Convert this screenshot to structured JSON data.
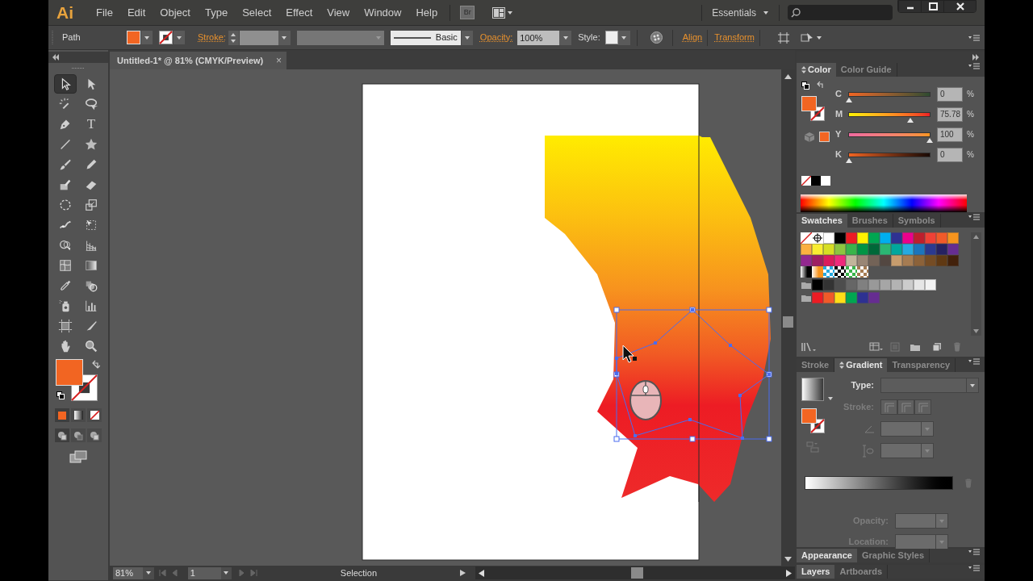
{
  "app": {
    "logo": "Ai",
    "bridge": "Br"
  },
  "menu": [
    "File",
    "Edit",
    "Object",
    "Type",
    "Select",
    "Effect",
    "View",
    "Window",
    "Help"
  ],
  "workspace": {
    "label": "Essentials"
  },
  "control_bar": {
    "selection": "Path",
    "stroke_label": "Stroke:",
    "stroke_profile": "Basic",
    "opacity_label": "Opacity:",
    "opacity": "100%",
    "style_label": "Style:",
    "align": "Align",
    "transform": "Transform"
  },
  "fill": {
    "color": "#f26522"
  },
  "document_tab": {
    "title": "Untitled-1* @ 81% (CMYK/Preview)",
    "close": "×"
  },
  "tools": [
    {
      "kind": "selection",
      "selected": true
    },
    {
      "kind": "direct-selection",
      "selected": false
    },
    {
      "kind": "magic-wand",
      "selected": false
    },
    {
      "kind": "lasso",
      "selected": false
    },
    {
      "kind": "pen",
      "selected": false
    },
    {
      "kind": "type",
      "glyph": "T",
      "selected": false
    },
    {
      "kind": "line",
      "selected": false
    },
    {
      "kind": "star",
      "selected": false
    },
    {
      "kind": "paintbrush",
      "selected": false
    },
    {
      "kind": "pencil",
      "selected": false
    },
    {
      "kind": "blob-brush",
      "selected": false
    },
    {
      "kind": "eraser",
      "selected": false
    },
    {
      "kind": "rotate",
      "selected": false
    },
    {
      "kind": "scale",
      "selected": false
    },
    {
      "kind": "warp",
      "selected": false
    },
    {
      "kind": "free-transform",
      "selected": false
    },
    {
      "kind": "shape-builder",
      "selected": false
    },
    {
      "kind": "perspective-grid",
      "selected": false
    },
    {
      "kind": "mesh",
      "selected": false
    },
    {
      "kind": "gradient",
      "selected": false
    },
    {
      "kind": "eyedropper",
      "selected": false
    },
    {
      "kind": "blend",
      "selected": false
    },
    {
      "kind": "symbol-sprayer",
      "selected": false
    },
    {
      "kind": "column-graph",
      "selected": false
    },
    {
      "kind": "artboard",
      "selected": false
    },
    {
      "kind": "slice",
      "selected": false
    },
    {
      "kind": "hand",
      "selected": false
    },
    {
      "kind": "zoom",
      "selected": false
    }
  ],
  "color_panel": {
    "tabs": [
      {
        "label": "Color",
        "selected": true,
        "collapsible": true
      },
      {
        "label": "Color Guide",
        "selected": false
      }
    ],
    "channels": [
      {
        "label": "C",
        "value": "0",
        "unit": "%",
        "level": 0
      },
      {
        "label": "M",
        "value": "75.78",
        "unit": "%",
        "level": 0.7578
      },
      {
        "label": "Y",
        "value": "100",
        "unit": "%",
        "level": 1
      },
      {
        "label": "K",
        "value": "0",
        "unit": "%",
        "level": 0
      }
    ]
  },
  "swatches_panel": {
    "tabs": [
      {
        "label": "Swatches",
        "selected": true
      },
      {
        "label": "Brushes",
        "selected": false
      },
      {
        "label": "Symbols",
        "selected": false
      }
    ],
    "rows": [
      [
        {
          "kind": "none"
        },
        {
          "kind": "registration"
        },
        {
          "kind": "color",
          "color": "#ffffff"
        },
        {
          "kind": "color",
          "color": "#000000"
        },
        {
          "kind": "color",
          "color": "#ed1c24"
        },
        {
          "kind": "color",
          "color": "#fff200"
        },
        {
          "kind": "color",
          "color": "#00a651"
        },
        {
          "kind": "color",
          "color": "#00aeef"
        },
        {
          "kind": "color",
          "color": "#2e3192"
        },
        {
          "kind": "color",
          "color": "#ec008c"
        },
        {
          "kind": "color",
          "color": "#be1e2d"
        },
        {
          "kind": "color",
          "color": "#ef4136"
        },
        {
          "kind": "color",
          "color": "#f15a29"
        },
        {
          "kind": "color",
          "color": "#f7941d"
        }
      ],
      [
        {
          "kind": "color",
          "color": "#fbb040"
        },
        {
          "kind": "color",
          "color": "#f9ed32"
        },
        {
          "kind": "color",
          "color": "#d7df23"
        },
        {
          "kind": "color",
          "color": "#8dc63f"
        },
        {
          "kind": "color",
          "color": "#39b54a"
        },
        {
          "kind": "color",
          "color": "#009444"
        },
        {
          "kind": "color",
          "color": "#006838"
        },
        {
          "kind": "color",
          "color": "#2bb673"
        },
        {
          "kind": "color",
          "color": "#00a79d"
        },
        {
          "kind": "color",
          "color": "#27aae1"
        },
        {
          "kind": "color",
          "color": "#1c75bc"
        },
        {
          "kind": "color",
          "color": "#2b3990"
        },
        {
          "kind": "color",
          "color": "#262262"
        },
        {
          "kind": "color",
          "color": "#662d91"
        }
      ],
      [
        {
          "kind": "color",
          "color": "#92278f"
        },
        {
          "kind": "color",
          "color": "#9e1f63"
        },
        {
          "kind": "color",
          "color": "#da1c5c"
        },
        {
          "kind": "color",
          "color": "#ee2a7b"
        },
        {
          "kind": "color",
          "color": "#c2b59b"
        },
        {
          "kind": "color",
          "color": "#998675"
        },
        {
          "kind": "color",
          "color": "#736357"
        },
        {
          "kind": "color",
          "color": "#534741"
        },
        {
          "kind": "color",
          "color": "#c69c6d"
        },
        {
          "kind": "color",
          "color": "#a67c52"
        },
        {
          "kind": "color",
          "color": "#8c6239"
        },
        {
          "kind": "color",
          "color": "#754c24"
        },
        {
          "kind": "color",
          "color": "#603913"
        },
        {
          "kind": "color",
          "color": "#42210b"
        }
      ],
      [
        {
          "kind": "gradient",
          "color": "#000000"
        },
        {
          "kind": "gradient",
          "color": "#f7941d"
        },
        {
          "kind": "pattern",
          "color": "#27aae1"
        },
        {
          "kind": "pattern",
          "color": "#000000"
        },
        {
          "kind": "pattern",
          "color": "#39b54a"
        },
        {
          "kind": "pattern",
          "color": "#a67c52"
        }
      ],
      [
        {
          "kind": "folder"
        },
        {
          "kind": "color",
          "color": "#000000"
        },
        {
          "kind": "color",
          "color": "#333333"
        },
        {
          "kind": "color",
          "color": "#4d4d4d"
        },
        {
          "kind": "color",
          "color": "#666666"
        },
        {
          "kind": "color",
          "color": "#808080"
        },
        {
          "kind": "color",
          "color": "#999999"
        },
        {
          "kind": "color",
          "color": "#a6a6a6"
        },
        {
          "kind": "color",
          "color": "#b3b3b3"
        },
        {
          "kind": "color",
          "color": "#cccccc"
        },
        {
          "kind": "color",
          "color": "#e6e6e6"
        },
        {
          "kind": "color",
          "color": "#f2f2f2"
        }
      ],
      [
        {
          "kind": "folder"
        },
        {
          "kind": "color",
          "color": "#ed1c24"
        },
        {
          "kind": "color",
          "color": "#f15a29"
        },
        {
          "kind": "color",
          "color": "#ffde17"
        },
        {
          "kind": "color",
          "color": "#00a651"
        },
        {
          "kind": "color",
          "color": "#2e3192"
        },
        {
          "kind": "color",
          "color": "#662d91"
        }
      ]
    ]
  },
  "gradient_panel": {
    "tabs": [
      {
        "label": "Stroke",
        "selected": false
      },
      {
        "label": "Gradient",
        "selected": true,
        "collapsible": true
      },
      {
        "label": "Transparency",
        "selected": false
      }
    ],
    "fields": [
      {
        "kind": "type",
        "label": "Type:",
        "disabled": false
      },
      {
        "kind": "stroke",
        "label": "Stroke:",
        "disabled": true
      },
      {
        "kind": "angle",
        "disabled": true
      },
      {
        "kind": "aspect",
        "disabled": true
      },
      {
        "kind": "opacity",
        "label": "Opacity:",
        "disabled": true
      },
      {
        "kind": "location",
        "label": "Location:",
        "disabled": true
      }
    ]
  },
  "appearance_panel": {
    "tabs": [
      {
        "label": "Appearance",
        "selected": true
      },
      {
        "label": "Graphic Styles",
        "selected": false
      }
    ]
  },
  "layers_panel": {
    "tabs": [
      {
        "label": "Layers",
        "selected": true
      },
      {
        "label": "Artboards",
        "selected": false
      }
    ]
  },
  "status_bar": {
    "zoom": "81%",
    "artboard": "1",
    "tool": "Selection"
  }
}
